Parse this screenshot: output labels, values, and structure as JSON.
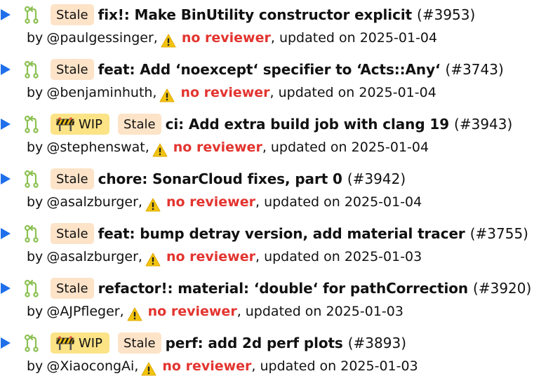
{
  "colors": {
    "toggle": "#1f6feb",
    "pr_icon": "#8cc152",
    "stale_bg": "#fde3c8",
    "wip_bg": "#fbe386",
    "no_reviewer": "#e3342f",
    "warning": "#f2c40f"
  },
  "icons": {
    "toggle": "triangle-right-icon",
    "pr": "pull-request-icon",
    "wip": "construction-barrier-icon",
    "warning": "warning-icon"
  },
  "pull_requests": [
    {
      "wip_label": "",
      "stale_label": "Stale",
      "title": "fix!: Make BinUtility constructor explicit",
      "number": "(#3953)",
      "by": "by",
      "author": "@paulgessinger,",
      "no_reviewer": "no reviewer",
      "updated": ", updated on 2025-01-04"
    },
    {
      "wip_label": "",
      "stale_label": "Stale",
      "title": "feat: Add ‘noexcept‘ specifier to ‘Acts::Any‘",
      "number": "(#3743)",
      "by": "by",
      "author": "@benjaminhuth,",
      "no_reviewer": "no reviewer",
      "updated": ", updated on 2025-01-04"
    },
    {
      "wip_label": "WIP",
      "stale_label": "Stale",
      "title": "ci: Add extra build job with clang 19",
      "number": "(#3943)",
      "by": "by",
      "author": "@stephenswat,",
      "no_reviewer": "no reviewer",
      "updated": ", updated on 2025-01-04"
    },
    {
      "wip_label": "",
      "stale_label": "Stale",
      "title": "chore: SonarCloud fixes, part 0",
      "number": "(#3942)",
      "by": "by",
      "author": "@asalzburger,",
      "no_reviewer": "no reviewer",
      "updated": ", updated on 2025-01-04"
    },
    {
      "wip_label": "",
      "stale_label": "Stale",
      "title": "feat: bump detray version, add material tracer",
      "number": "(#3755)",
      "by": "by",
      "author": "@asalzburger,",
      "no_reviewer": "no reviewer",
      "updated": ", updated on 2025-01-03"
    },
    {
      "wip_label": "",
      "stale_label": "Stale",
      "title": "refactor!: material: ‘double‘ for pathCorrection",
      "number": "(#3920)",
      "by": "by",
      "author": "@AJPfleger,",
      "no_reviewer": "no reviewer",
      "updated": ", updated on 2025-01-03"
    },
    {
      "wip_label": "WIP",
      "stale_label": "Stale",
      "title": "perf: add 2d perf plots",
      "number": "(#3893)",
      "by": "by",
      "author": "@XiaocongAi,",
      "no_reviewer": "no reviewer",
      "updated": ", updated on 2025-01-03"
    }
  ]
}
